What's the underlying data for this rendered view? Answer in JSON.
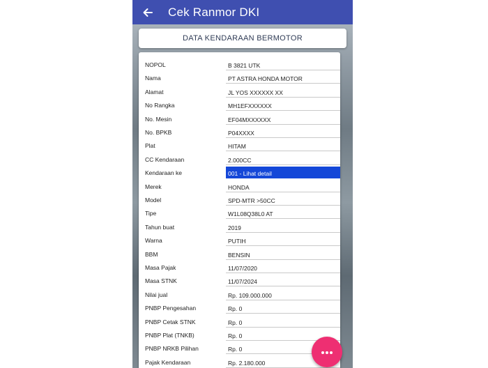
{
  "appbar": {
    "title": "Cek Ranmor DKI",
    "back_icon": "arrow-left-icon"
  },
  "section": {
    "title": "DATA KENDARAAN BERMOTOR"
  },
  "colors": {
    "appbar": "#3f4fb0",
    "selection": "#1447d8",
    "fab": "#ee2f72"
  },
  "rows": [
    {
      "label": "NOPOL",
      "value": "B 3821 UTK"
    },
    {
      "label": "Nama",
      "value": "PT ASTRA HONDA MOTOR"
    },
    {
      "label": "Alamat",
      "value": "JL YOS  XXXXXX XX"
    },
    {
      "label": "No Rangka",
      "value": "MH1EFXXXXXX"
    },
    {
      "label": "No. Mesin",
      "value": "EF04MXXXXXX"
    },
    {
      "label": "No. BPKB",
      "value": "P04XXXX"
    },
    {
      "label": "Plat",
      "value": "HITAM"
    },
    {
      "label": "CC Kendaraan",
      "value": "2.000CC"
    },
    {
      "label": "Kendaraan ke",
      "value": "001 - Lihat detail",
      "selected": true
    },
    {
      "label": "Merek",
      "value": "HONDA"
    },
    {
      "label": "Model",
      "value": "SPD-MTR >50CC"
    },
    {
      "label": "Tipe",
      "value": "W1L08Q38L0 AT"
    },
    {
      "label": "Tahun buat",
      "value": "2019"
    },
    {
      "label": "Warna",
      "value": "PUTIH"
    },
    {
      "label": "BBM",
      "value": "BENSIN"
    },
    {
      "label": "Masa Pajak",
      "value": "11/07/2020"
    },
    {
      "label": "Masa STNK",
      "value": "11/07/2024"
    },
    {
      "label": "Nilai jual",
      "value": "Rp. 109.000.000"
    },
    {
      "label": "PNBP Pengesahan",
      "value": "Rp. 0"
    },
    {
      "label": "PNBP Cetak STNK",
      "value": "Rp. 0"
    },
    {
      "label": "PNBP Plat (TNKB)",
      "value": "Rp. 0"
    },
    {
      "label": "PNBP NRKB Pilihan",
      "value": "Rp. 0"
    },
    {
      "label": "Pajak Kendaraan",
      "value": "Rp. 2.180.000"
    }
  ],
  "fab": {
    "icon": "more-horizontal-icon"
  }
}
